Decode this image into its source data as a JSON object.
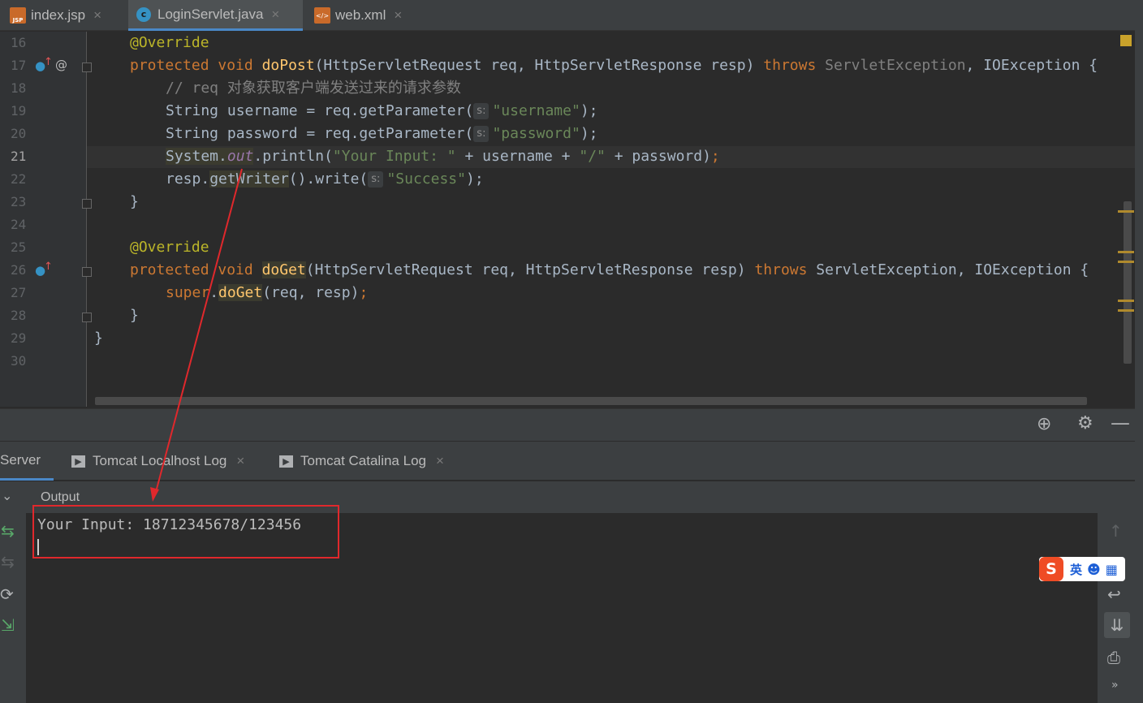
{
  "tabs": [
    {
      "label": "index.jsp",
      "icon": "jsp-file-icon",
      "active": false
    },
    {
      "label": "LoginServlet.java",
      "icon": "java-class-icon",
      "active": true
    },
    {
      "label": "web.xml",
      "icon": "xml-file-icon",
      "active": false
    }
  ],
  "editor": {
    "current_line": 21,
    "lines": [
      "16",
      "17",
      "18",
      "19",
      "20",
      "21",
      "22",
      "23",
      "24",
      "25",
      "26",
      "27",
      "28",
      "29",
      "30"
    ],
    "code": {
      "l16": "@Override",
      "l17_kw": "protected void ",
      "l17_fn": "doPost",
      "l17_sig": "(HttpServletRequest req, HttpServletResponse resp) ",
      "l17_throws": "throws ",
      "l17_ex1": "ServletException",
      "l17_ex2": ", IOException {",
      "l18": "// req 对象获取客户端发送过来的请求参数",
      "l19_a": "String username = req.getParameter(",
      "l19_hint": "s:",
      "l19_str": "\"username\"",
      "l19_end": ");",
      "l20_a": "String password = req.getParameter(",
      "l20_hint": "s:",
      "l20_str": "\"password\"",
      "l20_end": ");",
      "l21_a": "System.",
      "l21_out": "out",
      "l21_b": ".println(",
      "l21_str": "\"Your Input: \"",
      "l21_c": " + username + ",
      "l21_str2": "\"/\"",
      "l21_d": " + password)",
      "l21_semi": ";",
      "l22_a": "resp.",
      "l22_gw": "getWriter",
      "l22_b": "().write(",
      "l22_hint": "s:",
      "l22_str": "\"Success\"",
      "l22_end": ");",
      "l23": "}",
      "l25": "@Override",
      "l26_kw": "protected void ",
      "l26_fn": "doGet",
      "l26_sig": "(HttpServletRequest req, HttpServletResponse resp) ",
      "l26_throws": "throws ",
      "l26_ex": "ServletException, IOException {",
      "l27_super": "super",
      "l27_dot": ".",
      "l27_fn": "doGet",
      "l27_args": "(req, resp)",
      "l27_semi": ";",
      "l28": "}",
      "l29": "}"
    }
  },
  "tool_window": {
    "tabs": [
      {
        "label": "Server",
        "active": true
      },
      {
        "label": "Tomcat Localhost Log",
        "active": false
      },
      {
        "label": "Tomcat Catalina Log",
        "active": false
      }
    ],
    "output_label": "Output",
    "console_lines": [
      "Your Input: 18712345678/123456"
    ]
  },
  "ime": {
    "mode": "英"
  },
  "colors": {
    "keyword": "#cc7832",
    "annotation": "#bbb529",
    "method": "#ffc66d",
    "string": "#6a8759",
    "comment": "#808080",
    "highlight_box": "#e0282c"
  }
}
